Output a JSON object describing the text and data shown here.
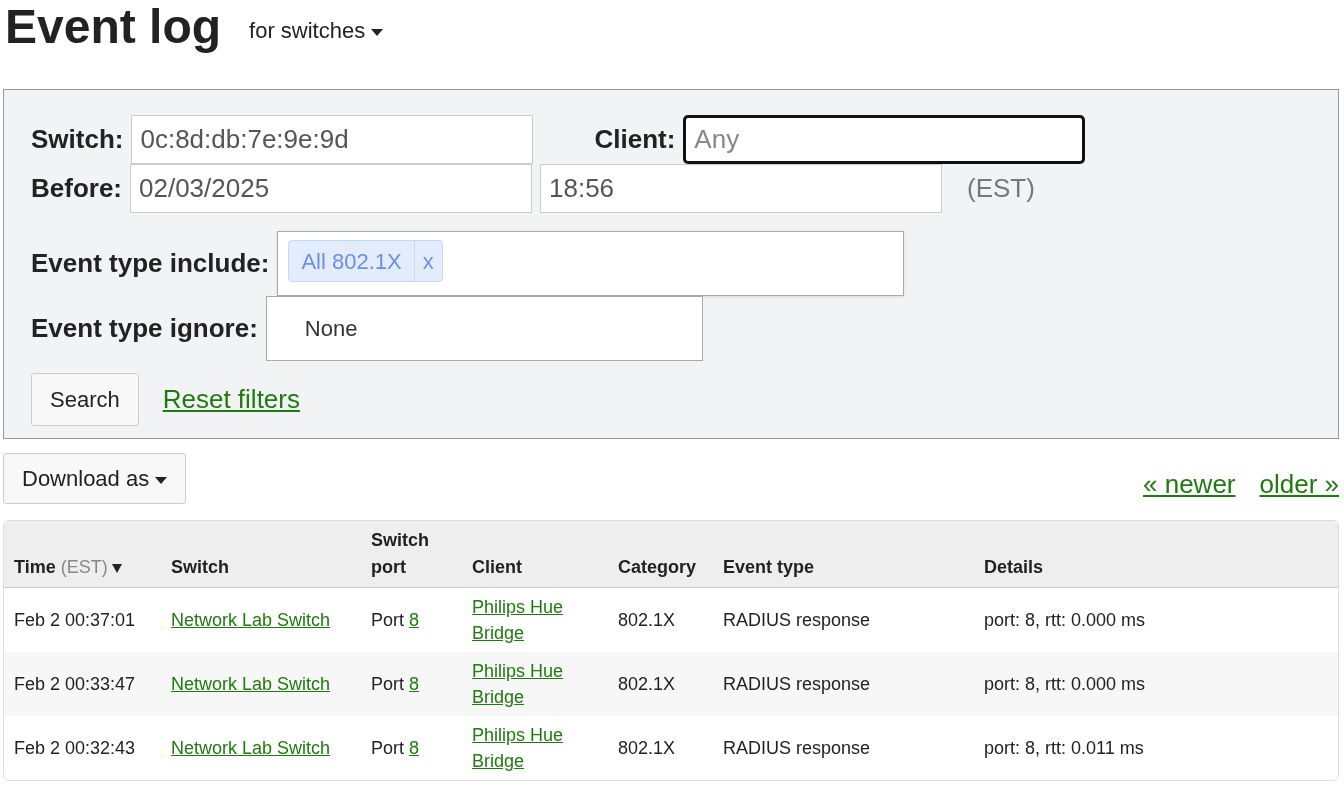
{
  "page": {
    "title": "Event log",
    "scope_menu": "for switches"
  },
  "filters": {
    "switch": {
      "label": "Switch:",
      "value": "0c:8d:db:7e:9e:9d"
    },
    "client": {
      "label": "Client:",
      "placeholder": "Any",
      "focused": true
    },
    "before": {
      "label": "Before:",
      "date": "02/03/2025",
      "time": "18:56",
      "timezone": "(EST)"
    },
    "include": {
      "label": "Event type include:",
      "tags": [
        {
          "label": "All 802.1X",
          "remove": "x"
        }
      ]
    },
    "ignore": {
      "label": "Event type ignore:",
      "placeholder": "None"
    },
    "search_button": "Search",
    "reset_link": "Reset filters"
  },
  "download_button": "Download as",
  "pagination": {
    "newer": "« newer",
    "older": "older »"
  },
  "table": {
    "columns": [
      {
        "label": "Time",
        "note": "(EST)",
        "sorted": true
      },
      {
        "label": "Switch",
        "sorted": false
      },
      {
        "label": "Switch port",
        "sorted": false
      },
      {
        "label": "Client",
        "sorted": false
      },
      {
        "label": "Category",
        "sorted": false
      },
      {
        "label": "Event type",
        "sorted": false
      },
      {
        "label": "Details",
        "sorted": false
      }
    ],
    "rows": [
      {
        "time": "Feb 2 00:37:01",
        "switch": "Network Lab Switch",
        "port_label": "Port",
        "port": "8",
        "client": "Philips Hue Bridge",
        "category": "802.1X",
        "event_type": "RADIUS response",
        "details": "port: 8, rtt: 0.000 ms"
      },
      {
        "time": "Feb 2 00:33:47",
        "switch": "Network Lab Switch",
        "port_label": "Port",
        "port": "8",
        "client": "Philips Hue Bridge",
        "category": "802.1X",
        "event_type": "RADIUS response",
        "details": "port: 8, rtt: 0.000 ms"
      },
      {
        "time": "Feb 2 00:32:43",
        "switch": "Network Lab Switch",
        "port_label": "Port",
        "port": "8",
        "client": "Philips Hue Bridge",
        "category": "802.1X",
        "event_type": "RADIUS response",
        "details": "port: 8, rtt: 0.011 ms"
      }
    ]
  }
}
